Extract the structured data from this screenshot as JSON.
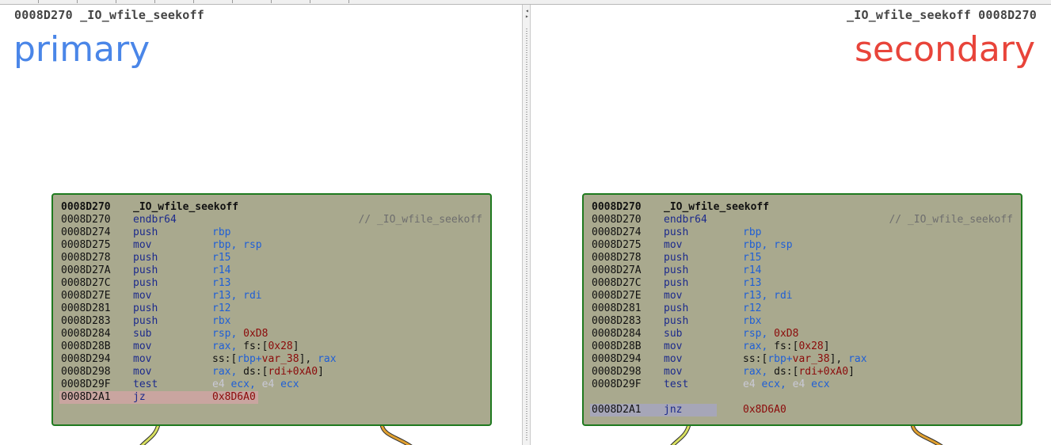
{
  "primary": {
    "header": "0008D270 _IO_wfile_seekoff",
    "label": "primary",
    "block_title": {
      "addr": "0008D270",
      "name": "_IO_wfile_seekoff"
    },
    "comment": "// _IO_wfile_seekoff",
    "lines": [
      {
        "addr": "0008D270",
        "mnem": "endbr64",
        "ops": []
      },
      {
        "addr": "0008D274",
        "mnem": "push",
        "ops": [
          {
            "t": "rbp",
            "k": "reg"
          }
        ]
      },
      {
        "addr": "0008D275",
        "mnem": "mov",
        "ops": [
          {
            "t": "rbp, rsp",
            "k": "reg"
          }
        ]
      },
      {
        "addr": "0008D278",
        "mnem": "push",
        "ops": [
          {
            "t": "r15",
            "k": "reg"
          }
        ]
      },
      {
        "addr": "0008D27A",
        "mnem": "push",
        "ops": [
          {
            "t": "r14",
            "k": "reg"
          }
        ]
      },
      {
        "addr": "0008D27C",
        "mnem": "push",
        "ops": [
          {
            "t": "r13",
            "k": "reg"
          }
        ]
      },
      {
        "addr": "0008D27E",
        "mnem": "mov",
        "ops": [
          {
            "t": "r13, rdi",
            "k": "reg"
          }
        ]
      },
      {
        "addr": "0008D281",
        "mnem": "push",
        "ops": [
          {
            "t": "r12",
            "k": "reg"
          }
        ]
      },
      {
        "addr": "0008D283",
        "mnem": "push",
        "ops": [
          {
            "t": "rbx",
            "k": "reg"
          }
        ]
      },
      {
        "addr": "0008D284",
        "mnem": "sub",
        "ops": [
          {
            "t": "rsp, ",
            "k": "reg"
          },
          {
            "t": "0xD8",
            "k": "num"
          }
        ]
      },
      {
        "addr": "0008D28B",
        "mnem": "mov",
        "ops": [
          {
            "t": "rax, ",
            "k": "reg"
          },
          {
            "t": "fs:[",
            "k": "seg"
          },
          {
            "t": "0x28",
            "k": "num"
          },
          {
            "t": "]",
            "k": "seg"
          }
        ]
      },
      {
        "addr": "0008D294",
        "mnem": "mov",
        "ops": [
          {
            "t": "ss:[",
            "k": "seg"
          },
          {
            "t": "rbp+",
            "k": "reg"
          },
          {
            "t": "var_38",
            "k": "num"
          },
          {
            "t": "], ",
            "k": "seg"
          },
          {
            "t": "rax",
            "k": "reg"
          }
        ]
      },
      {
        "addr": "0008D298",
        "mnem": "mov",
        "ops": [
          {
            "t": "rax, ",
            "k": "reg"
          },
          {
            "t": "ds:[",
            "k": "seg"
          },
          {
            "t": "rdi+",
            "k": "num"
          },
          {
            "t": "0xA0",
            "k": "num"
          },
          {
            "t": "]",
            "k": "seg"
          }
        ]
      },
      {
        "addr": "0008D29F",
        "mnem": "test",
        "ops": [
          {
            "t": "e4 ",
            "k": "faded"
          },
          {
            "t": "ecx, ",
            "k": "reg"
          },
          {
            "t": "e4 ",
            "k": "faded"
          },
          {
            "t": "ecx",
            "k": "reg"
          }
        ]
      }
    ],
    "last": {
      "addr": "0008D2A1",
      "mnem": "jz",
      "target": "0x8D6A0"
    }
  },
  "secondary": {
    "header": "_IO_wfile_seekoff 0008D270",
    "label": "secondary",
    "block_title": {
      "addr": "0008D270",
      "name": "_IO_wfile_seekoff"
    },
    "comment": "// _IO_wfile_seekoff",
    "lines": [
      {
        "addr": "0008D270",
        "mnem": "endbr64",
        "ops": []
      },
      {
        "addr": "0008D274",
        "mnem": "push",
        "ops": [
          {
            "t": "rbp",
            "k": "reg"
          }
        ]
      },
      {
        "addr": "0008D275",
        "mnem": "mov",
        "ops": [
          {
            "t": "rbp, rsp",
            "k": "reg"
          }
        ]
      },
      {
        "addr": "0008D278",
        "mnem": "push",
        "ops": [
          {
            "t": "r15",
            "k": "reg"
          }
        ]
      },
      {
        "addr": "0008D27A",
        "mnem": "push",
        "ops": [
          {
            "t": "r14",
            "k": "reg"
          }
        ]
      },
      {
        "addr": "0008D27C",
        "mnem": "push",
        "ops": [
          {
            "t": "r13",
            "k": "reg"
          }
        ]
      },
      {
        "addr": "0008D27E",
        "mnem": "mov",
        "ops": [
          {
            "t": "r13, rdi",
            "k": "reg"
          }
        ]
      },
      {
        "addr": "0008D281",
        "mnem": "push",
        "ops": [
          {
            "t": "r12",
            "k": "reg"
          }
        ]
      },
      {
        "addr": "0008D283",
        "mnem": "push",
        "ops": [
          {
            "t": "rbx",
            "k": "reg"
          }
        ]
      },
      {
        "addr": "0008D284",
        "mnem": "sub",
        "ops": [
          {
            "t": "rsp, ",
            "k": "reg"
          },
          {
            "t": "0xD8",
            "k": "num"
          }
        ]
      },
      {
        "addr": "0008D28B",
        "mnem": "mov",
        "ops": [
          {
            "t": "rax, ",
            "k": "reg"
          },
          {
            "t": "fs:[",
            "k": "seg"
          },
          {
            "t": "0x28",
            "k": "num"
          },
          {
            "t": "]",
            "k": "seg"
          }
        ]
      },
      {
        "addr": "0008D294",
        "mnem": "mov",
        "ops": [
          {
            "t": "ss:[",
            "k": "seg"
          },
          {
            "t": "rbp+",
            "k": "reg"
          },
          {
            "t": "var_38",
            "k": "num"
          },
          {
            "t": "], ",
            "k": "seg"
          },
          {
            "t": "rax",
            "k": "reg"
          }
        ]
      },
      {
        "addr": "0008D298",
        "mnem": "mov",
        "ops": [
          {
            "t": "rax, ",
            "k": "reg"
          },
          {
            "t": "ds:[",
            "k": "seg"
          },
          {
            "t": "rdi+",
            "k": "num"
          },
          {
            "t": "0xA0",
            "k": "num"
          },
          {
            "t": "]",
            "k": "seg"
          }
        ]
      },
      {
        "addr": "0008D29F",
        "mnem": "test",
        "ops": [
          {
            "t": "e4 ",
            "k": "faded"
          },
          {
            "t": "ecx, ",
            "k": "reg"
          },
          {
            "t": "e4 ",
            "k": "faded"
          },
          {
            "t": "ecx",
            "k": "reg"
          }
        ]
      }
    ],
    "last": {
      "addr": "0008D2A1",
      "mnem": "jnz",
      "target": "0x8D6A0"
    }
  },
  "colors": {
    "primary_label": "#4a86e8",
    "secondary_label": "#e8443a",
    "block_bg": "#a9a98e",
    "block_border": "#1f7a1f",
    "mnemonic": "#1c2a8c",
    "register": "#1f5fd6",
    "immediate": "#8b0a0a",
    "diff_removed_highlight": "#c9a5a0",
    "diff_changed_highlight": "#a6a6b8",
    "edge_true": "#2e8b2e",
    "edge_false": "#c0281e"
  },
  "icons": {
    "splitter_grip": "double-arrow-icon"
  }
}
